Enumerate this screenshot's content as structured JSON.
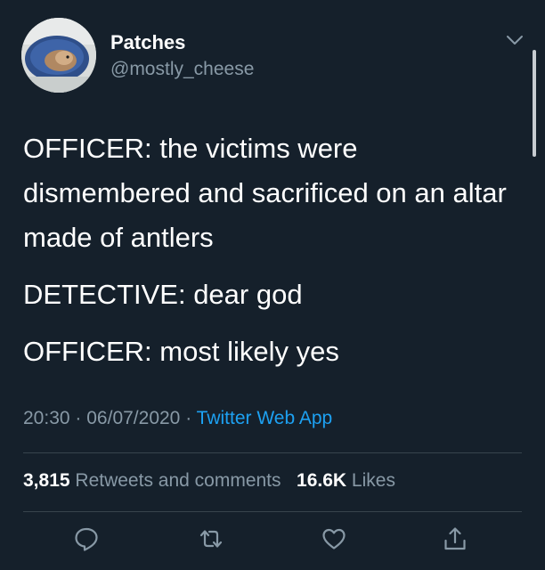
{
  "user": {
    "name": "Patches",
    "handle": "@mostly_cheese"
  },
  "tweet": {
    "lines": [
      "OFFICER: the victims were dismembered and sacrificed on an altar made of antlers",
      "DETECTIVE: dear god",
      "OFFICER: most likely yes"
    ],
    "time": "20:30",
    "date": "06/07/2020",
    "separator": "·",
    "source": "Twitter Web App"
  },
  "stats": {
    "retweets": "3,815",
    "retweets_label": "Retweets and comments",
    "likes": "16.6K",
    "likes_label": "Likes"
  },
  "icons": {
    "reply": "reply-icon",
    "retweet": "retweet-icon",
    "like": "heart-icon",
    "share": "share-icon",
    "menu": "chevron-down-icon"
  },
  "colors": {
    "background": "#15202b",
    "accent": "#1da1f2",
    "secondary_text": "#8899a6"
  }
}
